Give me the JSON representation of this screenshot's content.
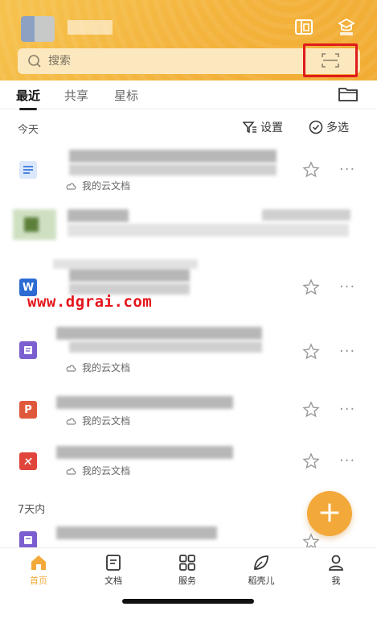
{
  "header": {
    "search_placeholder": "搜索",
    "accent_color": "#f3b23b",
    "icons": [
      "tablet-icon",
      "vip-icon",
      "scan-icon"
    ]
  },
  "tabs": [
    {
      "label": "最近",
      "active": true
    },
    {
      "label": "共享",
      "active": false
    },
    {
      "label": "星标",
      "active": false
    }
  ],
  "section": {
    "title": "今天",
    "settings_label": "设置",
    "multi_select_label": "多选"
  },
  "files": [
    {
      "type": "doc",
      "color": "#4a90e2",
      "subtitle": "我的云文档"
    },
    {
      "type": "image",
      "color": "#6a8f4c",
      "subtitle": ""
    },
    {
      "type": "word",
      "color": "#2d6bd3",
      "subtitle": ""
    },
    {
      "type": "note",
      "color": "#7b5fd0",
      "subtitle": "我的云文档"
    },
    {
      "type": "ppt",
      "color": "#e0583b",
      "subtitle": "我的云文档"
    },
    {
      "type": "pdf",
      "color": "#e0453b",
      "subtitle": "我的云文档"
    }
  ],
  "watermark": "www.dgrai.com",
  "week_section_title": "7天内",
  "fab_label": "+",
  "bottom_nav": [
    {
      "label": "首页",
      "icon": "home-icon",
      "active": true
    },
    {
      "label": "文档",
      "icon": "document-icon",
      "active": false
    },
    {
      "label": "服务",
      "icon": "grid-icon",
      "active": false
    },
    {
      "label": "稻壳儿",
      "icon": "leaf-icon",
      "active": false
    },
    {
      "label": "我",
      "icon": "person-icon",
      "active": false
    }
  ]
}
